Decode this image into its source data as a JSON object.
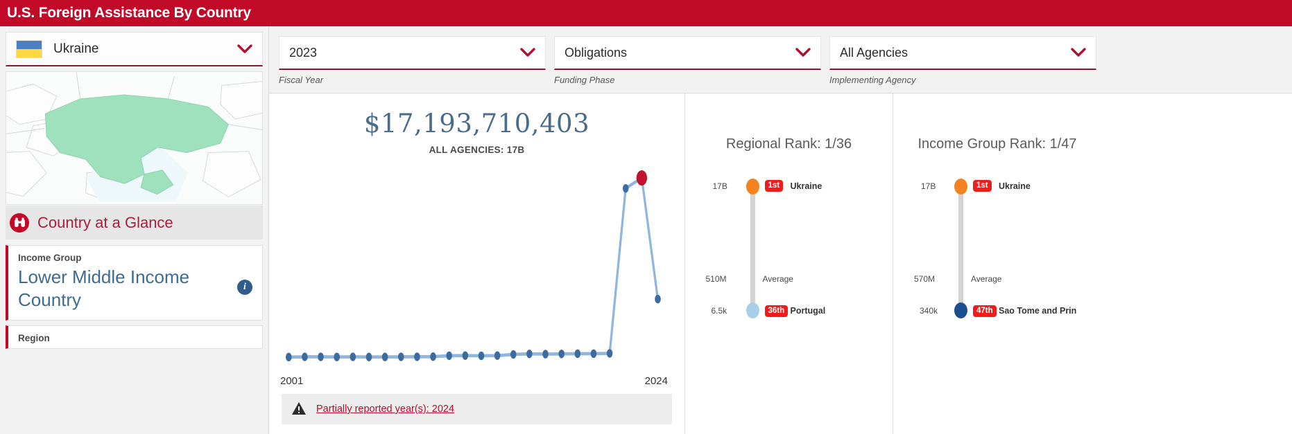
{
  "header": {
    "title": "U.S. Foreign Assistance By Country"
  },
  "sidebar": {
    "country": {
      "name": "Ukraine",
      "flag_top_color": "#4a7fc1",
      "flag_bottom_color": "#ffd93d"
    },
    "glance": {
      "title": "Country at a Glance",
      "icon": "binoculars-icon"
    },
    "income_group": {
      "label": "Income Group",
      "value": "Lower Middle Income Country",
      "info_icon": "info-icon"
    },
    "next_card": {
      "label": "Region"
    }
  },
  "filters": [
    {
      "name": "fiscal-year",
      "value": "2023",
      "label": "Fiscal Year"
    },
    {
      "name": "funding-phase",
      "value": "Obligations",
      "label": "Funding Phase"
    },
    {
      "name": "implementing-agency",
      "value": "All Agencies",
      "label": "Implementing Agency"
    }
  ],
  "spend": {
    "amount": "$17,193,710,403",
    "subtitle": "ALL AGENCIES: 17B",
    "warning": "Partially reported year(s): 2024",
    "warning_icon": "warning-triangle-icon"
  },
  "chart_data": {
    "type": "line",
    "title": "$17,193,710,403",
    "subtitle": "ALL AGENCIES: 17B",
    "xlabel": "",
    "ylabel": "",
    "grid": false,
    "legend": "none",
    "axis_tick_labels": {
      "x_first": "2001",
      "x_last": "2024"
    },
    "x": [
      2001,
      2002,
      2003,
      2004,
      2005,
      2006,
      2007,
      2008,
      2009,
      2010,
      2011,
      2012,
      2013,
      2014,
      2015,
      2016,
      2017,
      2018,
      2019,
      2020,
      2021,
      2022,
      2023,
      2024
    ],
    "values": [
      0.2,
      0.22,
      0.22,
      0.21,
      0.22,
      0.21,
      0.21,
      0.22,
      0.23,
      0.24,
      0.33,
      0.34,
      0.32,
      0.34,
      0.45,
      0.5,
      0.48,
      0.5,
      0.52,
      0.52,
      0.55,
      16.2,
      17.19,
      5.7
    ],
    "unit": "USD billions",
    "highlight_index": 22,
    "highlight_color": "#c1132e",
    "line_color": "#8fb6de",
    "point_color": "#3d6b9e",
    "ylim": [
      0,
      18
    ]
  },
  "ranks": [
    {
      "name": "regional-rank",
      "title": "Regional Rank: 1/36",
      "top": {
        "tick": "17B",
        "badge": "1st",
        "country": "Ukraine",
        "color": "#f58220"
      },
      "average_label": "Average",
      "average_value": "510M",
      "bottom": {
        "tick": "6.5k",
        "badge": "36th",
        "country": "Portugal",
        "color": "#a8cfe8"
      }
    },
    {
      "name": "income-group-rank",
      "title": "Income Group Rank: 1/47",
      "top": {
        "tick": "17B",
        "badge": "1st",
        "country": "Ukraine",
        "color": "#f58220"
      },
      "average_label": "Average",
      "average_value": "570M",
      "bottom": {
        "tick": "340k",
        "badge": "47th",
        "country": "Sao Tome and Prin",
        "color": "#1c4f8f"
      }
    }
  ],
  "colors": {
    "brand_red": "#c10a28",
    "accent_underline": "#8d1433",
    "amount_blue": "#4a6c8c",
    "map_highlight": "#9fe0bd"
  }
}
